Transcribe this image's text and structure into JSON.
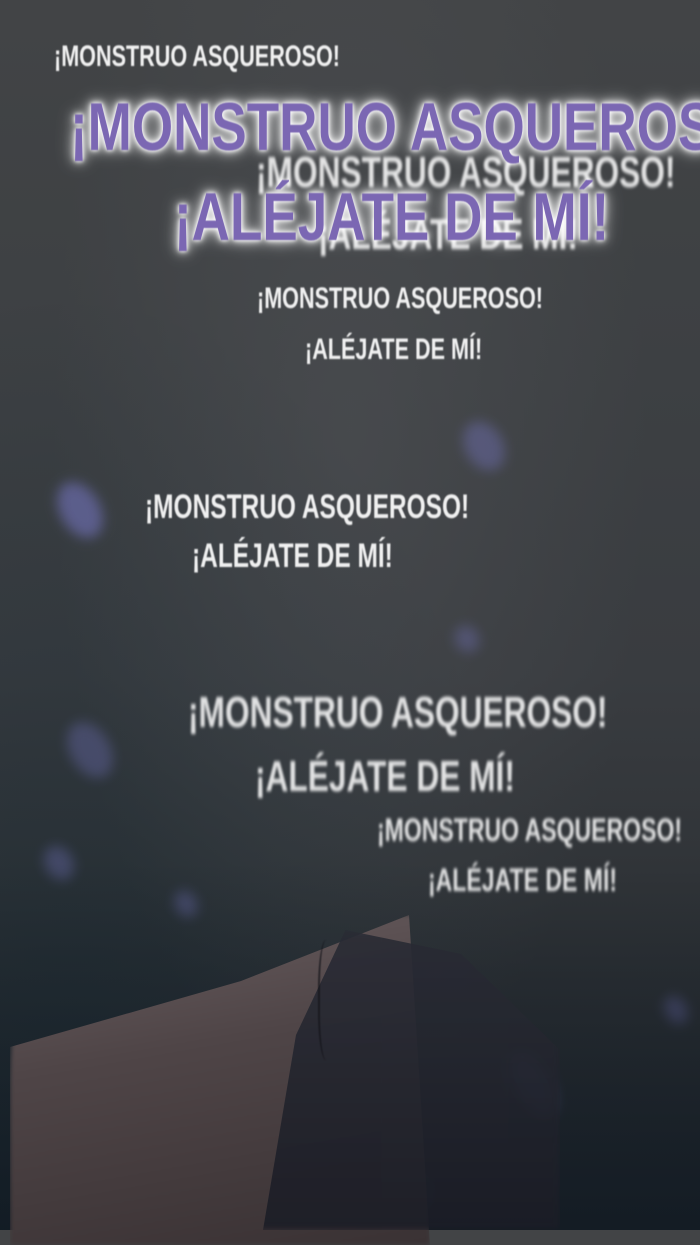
{
  "headline": {
    "line1": "¡MONSTRUO ASQUEROSO!",
    "line2": "¡ALÉJATE DE MÍ!"
  },
  "echoes": [
    {
      "line1": "¡MONSTRUO ASQUEROSO!",
      "line2": ""
    },
    {
      "line1": "¡MONSTRUO ASQUEROSO!",
      "line2": "¡ALÉJATE DE MÍ!"
    },
    {
      "line1": "¡MONSTRUO ASQUEROSO!",
      "line2": "¡ALÉJATE DE MÍ!"
    },
    {
      "line1": "¡MONSTRUO ASQUEROSO!",
      "line2": "¡ALÉJATE DE MÍ!"
    },
    {
      "line1": "¡MONSTRUO ASQUEROSO!",
      "line2": "¡ALÉJATE DE MÍ!"
    },
    {
      "line1": "¡MONSTRUO ASQUEROSO!",
      "line2": "¡ALÉJATE DE MÍ!"
    }
  ],
  "colors": {
    "headline_fill": "#7b67b3",
    "headline_glow": "#ffffff",
    "echo_text": "#ffffff",
    "background": "#3d4043"
  }
}
